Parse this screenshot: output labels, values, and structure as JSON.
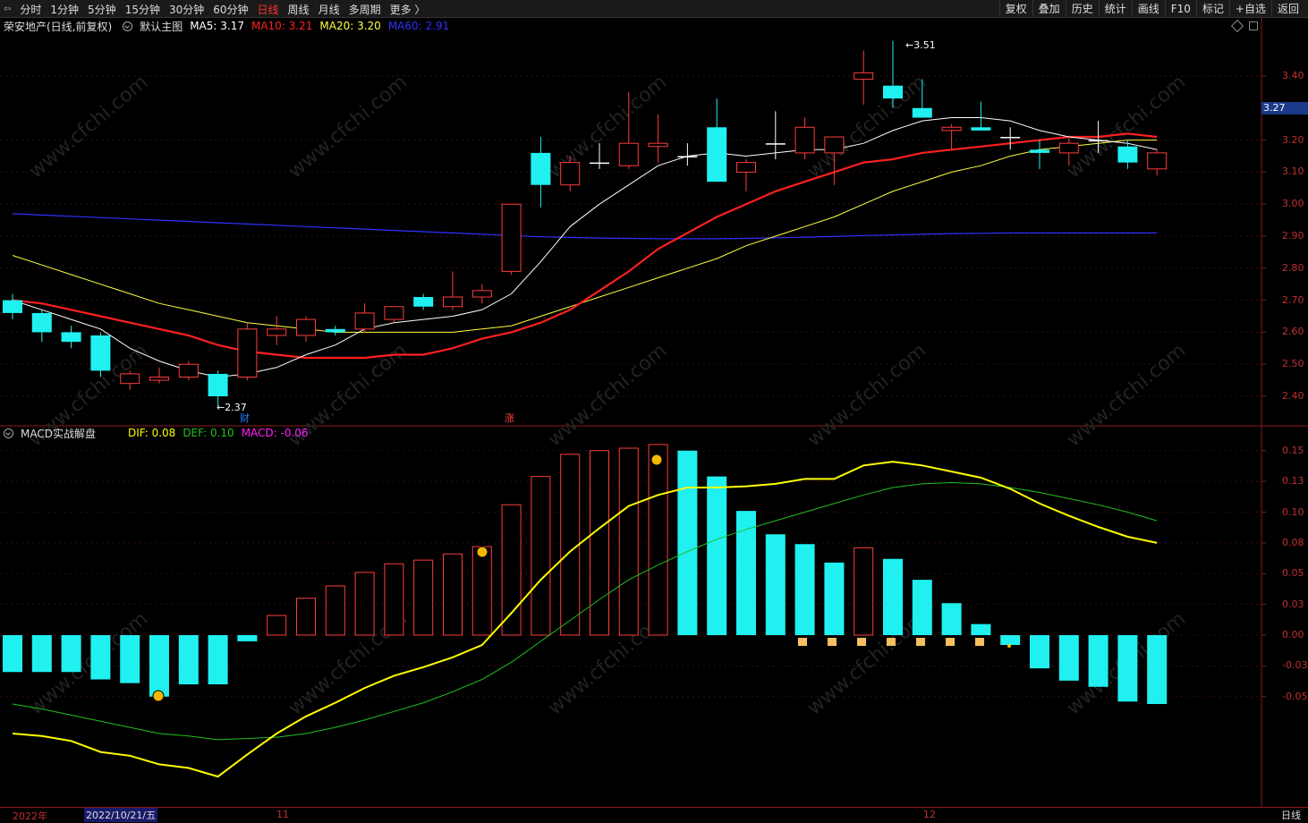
{
  "toolbar": {
    "back_icon": "window-back-icon",
    "periods": [
      "分时",
      "1分钟",
      "5分钟",
      "15分钟",
      "30分钟",
      "60分钟",
      "日线",
      "周线",
      "月线",
      "多周期",
      "更多 〉"
    ],
    "active_period_index": 6,
    "tools": [
      "复权",
      "叠加",
      "历史",
      "统计",
      "画线",
      "F10",
      "标记",
      "+自选",
      "返回"
    ]
  },
  "main_header": {
    "stock_name": "荣安地产(日线,前复权)",
    "template": "默认主图",
    "ma5": "MA5: 3.17",
    "ma10": "MA10: 3.21",
    "ma20": "MA20: 3.20",
    "ma60": "MA60: 2.91",
    "colors": {
      "ma5": "#ffffff",
      "ma10": "#ff2020",
      "ma20": "#ffff40",
      "ma60": "#3030ff"
    }
  },
  "macd_header": {
    "name": "MACD实战解盘",
    "dif": "DIF: 0.08",
    "def": "DEF: 0.10",
    "macd": "MACD: -0.06",
    "colors": {
      "dif": "#ffff00",
      "def": "#20c020",
      "macd": "#ff20ff"
    }
  },
  "price_axis": {
    "ticks": [
      "3.40",
      "3.20",
      "3.10",
      "3.00",
      "2.90",
      "2.80",
      "2.70",
      "2.60",
      "2.50",
      "2.40"
    ],
    "tick_values": [
      3.4,
      3.2,
      3.1,
      3.0,
      2.9,
      2.8,
      2.7,
      2.6,
      2.5,
      2.4
    ],
    "current": "3.27"
  },
  "macd_axis": {
    "ticks": [
      "0.15",
      "0.13",
      "0.10",
      "0.08",
      "0.05",
      "0.03",
      "0.00",
      "-0.03",
      "-0.05"
    ],
    "tick_values": [
      0.15,
      0.125,
      0.1,
      0.075,
      0.05,
      0.025,
      0,
      -0.025,
      -0.05
    ]
  },
  "annotations": {
    "high_label": "3.51",
    "low_label": "2.37",
    "cai_mark": "财",
    "zhang_mark": "涨"
  },
  "bottom_axis": {
    "year": "2022年",
    "cursor_date": "2022/10/21/五",
    "nov": "11",
    "dec": "12",
    "period_label": "日线"
  },
  "chart_data": {
    "type": "candlestick",
    "candles": [
      {
        "o": 2.7,
        "h": 2.72,
        "l": 2.64,
        "c": 2.66
      },
      {
        "o": 2.66,
        "h": 2.67,
        "l": 2.57,
        "c": 2.6
      },
      {
        "o": 2.6,
        "h": 2.62,
        "l": 2.55,
        "c": 2.57
      },
      {
        "o": 2.59,
        "h": 2.6,
        "l": 2.46,
        "c": 2.48
      },
      {
        "o": 2.44,
        "h": 2.48,
        "l": 2.42,
        "c": 2.47
      },
      {
        "o": 2.45,
        "h": 2.49,
        "l": 2.44,
        "c": 2.46
      },
      {
        "o": 2.46,
        "h": 2.51,
        "l": 2.45,
        "c": 2.5
      },
      {
        "o": 2.47,
        "h": 2.48,
        "l": 2.37,
        "c": 2.4
      },
      {
        "o": 2.46,
        "h": 2.63,
        "l": 2.45,
        "c": 2.61
      },
      {
        "o": 2.59,
        "h": 2.65,
        "l": 2.56,
        "c": 2.61
      },
      {
        "o": 2.59,
        "h": 2.65,
        "l": 2.57,
        "c": 2.64
      },
      {
        "o": 2.61,
        "h": 2.62,
        "l": 2.59,
        "c": 2.6
      },
      {
        "o": 2.61,
        "h": 2.69,
        "l": 2.6,
        "c": 2.66
      },
      {
        "o": 2.64,
        "h": 2.68,
        "l": 2.63,
        "c": 2.68
      },
      {
        "o": 2.71,
        "h": 2.72,
        "l": 2.67,
        "c": 2.68
      },
      {
        "o": 2.68,
        "h": 2.79,
        "l": 2.67,
        "c": 2.71
      },
      {
        "o": 2.71,
        "h": 2.75,
        "l": 2.69,
        "c": 2.73
      },
      {
        "o": 2.79,
        "h": 3.0,
        "l": 2.78,
        "c": 3.0
      },
      {
        "o": 3.16,
        "h": 3.21,
        "l": 2.99,
        "c": 3.06
      },
      {
        "o": 3.06,
        "h": 3.15,
        "l": 3.04,
        "c": 3.13
      },
      {
        "o": 3.13,
        "h": 3.19,
        "l": 3.11,
        "c": 3.13
      },
      {
        "o": 3.12,
        "h": 3.35,
        "l": 3.11,
        "c": 3.19
      },
      {
        "o": 3.18,
        "h": 3.28,
        "l": 3.13,
        "c": 3.19
      },
      {
        "o": 3.15,
        "h": 3.19,
        "l": 3.12,
        "c": 3.15
      },
      {
        "o": 3.24,
        "h": 3.33,
        "l": 3.07,
        "c": 3.07
      },
      {
        "o": 3.1,
        "h": 3.14,
        "l": 3.04,
        "c": 3.13
      },
      {
        "o": 3.19,
        "h": 3.29,
        "l": 3.14,
        "c": 3.19
      },
      {
        "o": 3.16,
        "h": 3.27,
        "l": 3.14,
        "c": 3.24
      },
      {
        "o": 3.16,
        "h": 3.21,
        "l": 3.06,
        "c": 3.21
      },
      {
        "o": 3.39,
        "h": 3.48,
        "l": 3.31,
        "c": 3.41
      },
      {
        "o": 3.37,
        "h": 3.51,
        "l": 3.3,
        "c": 3.33
      },
      {
        "o": 3.3,
        "h": 3.39,
        "l": 3.27,
        "c": 3.27
      },
      {
        "o": 3.23,
        "h": 3.25,
        "l": 3.17,
        "c": 3.24
      },
      {
        "o": 3.24,
        "h": 3.32,
        "l": 3.23,
        "c": 3.23
      },
      {
        "o": 3.21,
        "h": 3.24,
        "l": 3.17,
        "c": 3.21
      },
      {
        "o": 3.17,
        "h": 3.2,
        "l": 3.11,
        "c": 3.16
      },
      {
        "o": 3.16,
        "h": 3.21,
        "l": 3.12,
        "c": 3.19
      },
      {
        "o": 3.2,
        "h": 3.26,
        "l": 3.16,
        "c": 3.2
      },
      {
        "o": 3.18,
        "h": 3.2,
        "l": 3.11,
        "c": 3.13
      },
      {
        "o": 3.11,
        "h": 3.17,
        "l": 3.09,
        "c": 3.16
      }
    ],
    "ma5": [
      2.7,
      2.67,
      2.64,
      2.61,
      2.55,
      2.51,
      2.48,
      2.46,
      2.47,
      2.49,
      2.53,
      2.56,
      2.61,
      2.63,
      2.64,
      2.65,
      2.67,
      2.72,
      2.82,
      2.93,
      3.0,
      3.06,
      3.12,
      3.15,
      3.16,
      3.15,
      3.16,
      3.17,
      3.17,
      3.19,
      3.23,
      3.26,
      3.27,
      3.27,
      3.26,
      3.23,
      3.21,
      3.2,
      3.19,
      3.17
    ],
    "ma10": [
      2.7,
      2.69,
      2.67,
      2.65,
      2.63,
      2.61,
      2.59,
      2.56,
      2.54,
      2.53,
      2.52,
      2.52,
      2.52,
      2.53,
      2.53,
      2.55,
      2.58,
      2.6,
      2.63,
      2.67,
      2.73,
      2.79,
      2.86,
      2.91,
      2.96,
      3.0,
      3.04,
      3.07,
      3.1,
      3.13,
      3.14,
      3.16,
      3.17,
      3.18,
      3.19,
      3.2,
      3.21,
      3.21,
      3.22,
      3.21
    ],
    "ma20": [
      2.84,
      2.81,
      2.78,
      2.75,
      2.72,
      2.69,
      2.67,
      2.65,
      2.63,
      2.62,
      2.61,
      2.6,
      2.6,
      2.6,
      2.6,
      2.6,
      2.61,
      2.62,
      2.65,
      2.68,
      2.71,
      2.74,
      2.77,
      2.8,
      2.83,
      2.87,
      2.9,
      2.93,
      2.96,
      3.0,
      3.04,
      3.07,
      3.1,
      3.12,
      3.15,
      3.17,
      3.18,
      3.19,
      3.2,
      3.2
    ],
    "ma60": [
      2.97,
      2.966,
      2.962,
      2.958,
      2.954,
      2.95,
      2.946,
      2.942,
      2.938,
      2.934,
      2.93,
      2.926,
      2.922,
      2.918,
      2.914,
      2.91,
      2.906,
      2.902,
      2.898,
      2.896,
      2.894,
      2.893,
      2.892,
      2.892,
      2.892,
      2.893,
      2.895,
      2.897,
      2.899,
      2.902,
      2.904,
      2.906,
      2.908,
      2.909,
      2.91,
      2.91,
      2.91,
      2.91,
      2.91,
      2.91
    ],
    "macd": [
      -0.03,
      -0.03,
      -0.03,
      -0.036,
      -0.039,
      -0.05,
      -0.04,
      -0.04,
      -0.005,
      0.016,
      0.03,
      0.04,
      0.051,
      0.058,
      0.061,
      0.066,
      0.072,
      0.106,
      0.129,
      0.147,
      0.15,
      0.152,
      0.155,
      0.15,
      0.129,
      0.101,
      0.082,
      0.074,
      0.059,
      0.071,
      0.062,
      0.045,
      0.026,
      0.009,
      -0.008,
      -0.027,
      -0.037,
      -0.042,
      -0.054,
      -0.056
    ],
    "dif": [
      -0.08,
      -0.082,
      -0.086,
      -0.095,
      -0.098,
      -0.105,
      -0.108,
      -0.115,
      -0.097,
      -0.08,
      -0.066,
      -0.055,
      -0.043,
      -0.033,
      -0.026,
      -0.018,
      -0.008,
      0.018,
      0.045,
      0.068,
      0.087,
      0.105,
      0.114,
      0.12,
      0.12,
      0.121,
      0.123,
      0.127,
      0.127,
      0.138,
      0.141,
      0.138,
      0.133,
      0.128,
      0.119,
      0.107,
      0.097,
      0.088,
      0.08,
      0.075
    ],
    "def": [
      -0.056,
      -0.06,
      -0.065,
      -0.07,
      -0.075,
      -0.08,
      -0.082,
      -0.085,
      -0.084,
      -0.083,
      -0.08,
      -0.075,
      -0.069,
      -0.062,
      -0.055,
      -0.046,
      -0.036,
      -0.022,
      -0.005,
      0.012,
      0.029,
      0.045,
      0.057,
      0.068,
      0.078,
      0.086,
      0.093,
      0.1,
      0.107,
      0.114,
      0.12,
      0.123,
      0.124,
      0.123,
      0.12,
      0.116,
      0.111,
      0.106,
      0.1,
      0.093
    ]
  }
}
